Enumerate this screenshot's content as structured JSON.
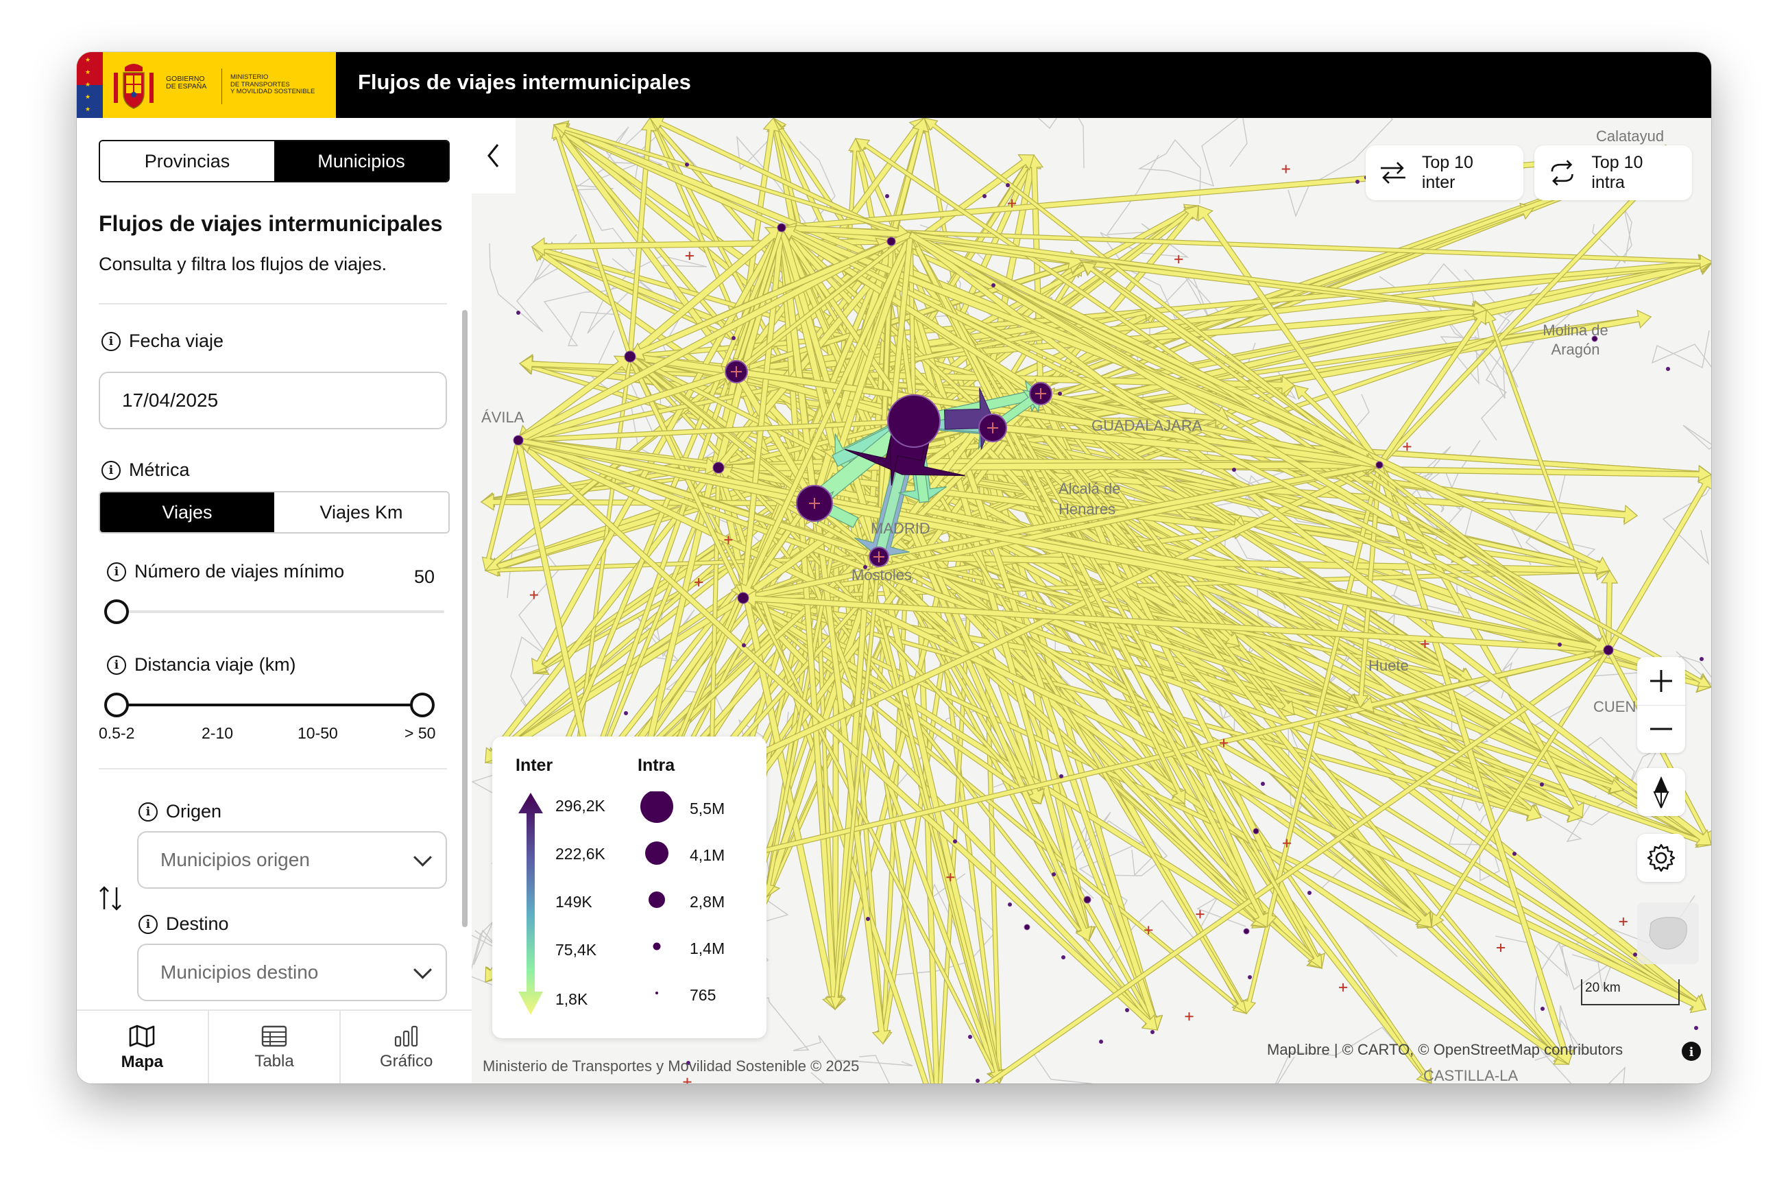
{
  "header": {
    "gov_line1": "GOBIERNO",
    "gov_line2": "DE ESPAÑA",
    "min_line1": "MINISTERIO",
    "min_line2": "DE TRANSPORTES",
    "min_line3": "Y MOVILIDAD SOSTENIBLE",
    "title": "Flujos de viajes intermunicipales"
  },
  "sidebar": {
    "scope_tabs": [
      {
        "label": "Provincias",
        "active": false
      },
      {
        "label": "Municipios",
        "active": true
      }
    ],
    "panel_title": "Flujos de viajes intermunicipales",
    "panel_subtitle": "Consulta y filtra los flujos de viajes.",
    "date_label": "Fecha viaje",
    "date_value": "17/04/2025",
    "metric_label": "Métrica",
    "metric_tabs": [
      {
        "label": "Viajes",
        "active": true
      },
      {
        "label": "Viajes Km",
        "active": false
      }
    ],
    "min_trips_label": "Número de viajes mínimo",
    "min_trips_value": "50",
    "distance_label": "Distancia viaje (km)",
    "distance_ticks": [
      "0.5-2",
      "2-10",
      "10-50",
      "> 50"
    ],
    "distance_range_selected": [
      "0.5-2",
      "> 50"
    ],
    "origin_label": "Origen",
    "origin_placeholder": "Municipios origen",
    "dest_label": "Destino",
    "dest_placeholder": "Municipios destino"
  },
  "bottom_nav": [
    {
      "label": "Mapa",
      "icon": "map-icon",
      "active": true
    },
    {
      "label": "Tabla",
      "icon": "table-icon",
      "active": false
    },
    {
      "label": "Gráfico",
      "icon": "bar-chart-icon",
      "active": false
    }
  ],
  "map": {
    "top_buttons": [
      {
        "label": "Top 10 inter",
        "icon": "swap-arrows-icon"
      },
      {
        "label": "Top 10 intra",
        "icon": "cycle-arrows-icon"
      }
    ],
    "place_labels": [
      "Calatayud",
      "Molina de Aragón",
      "ÁVILA",
      "GUADALAJARA",
      "Alcalá de Henares",
      "MADRID",
      "Móstoles",
      "Huete",
      "CUENCA",
      "CASTILLA-LA"
    ],
    "legend": {
      "inter_title": "Inter",
      "inter_values": [
        "296,2K",
        "222,6K",
        "149K",
        "75,4K",
        "1,8K"
      ],
      "intra_title": "Intra",
      "intra_values": [
        "5,5M",
        "4,1M",
        "2,8M",
        "1,4M",
        "765"
      ],
      "gradient_colors": [
        "#440154",
        "#5c5fa6",
        "#5fb0c4",
        "#8ff0a4",
        "#f5f57a"
      ]
    },
    "scale_label": "20 km",
    "attribution": "MapLibre | © CARTO, © OpenStreetMap contributors",
    "footer": "Ministerio de Transportes y Movilidad Sostenible © 2025",
    "colors": {
      "flow": "#f2f07a",
      "flow_stroke": "#b7b24a",
      "node": "#440154",
      "mid_flow": "#9ff0ae"
    }
  }
}
